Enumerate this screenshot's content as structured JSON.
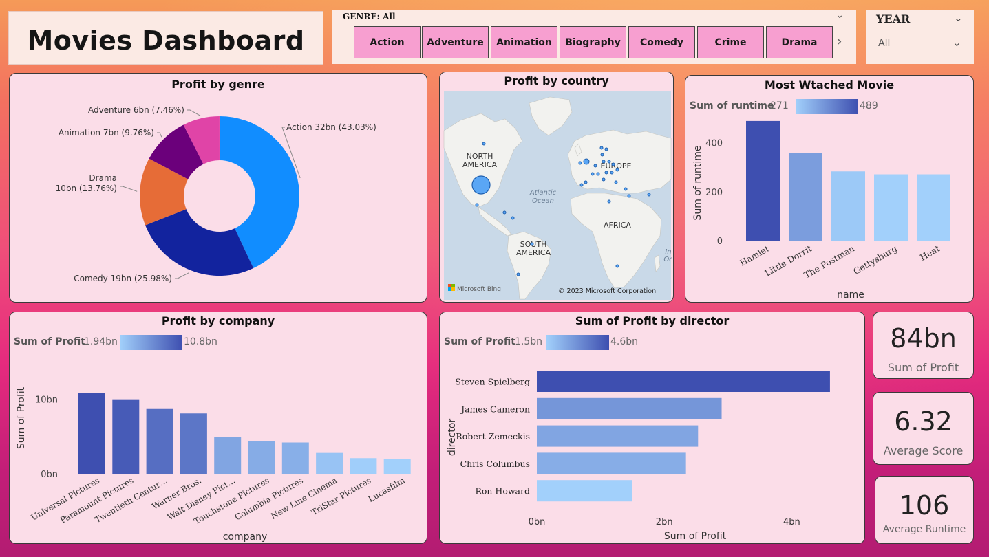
{
  "title": "Movies Dashboard",
  "genre_slicer": {
    "label": "GENRE: All",
    "buttons": [
      "Action",
      "Adventure",
      "Animation",
      "Biography",
      "Comedy",
      "Crime",
      "Drama"
    ]
  },
  "year_slicer": {
    "label": "YEAR",
    "value": "All"
  },
  "map": {
    "title": "Profit by country",
    "labels": [
      "NORTH\nAMERICA",
      "EUROPE",
      "AFRICA",
      "SOUTH\nAMERICA",
      "Atlantic\nOcean",
      "In\nOc"
    ],
    "attribution_bing": "Microsoft Bing",
    "copyright": "© 2023 Microsoft Corporation"
  },
  "kpis": [
    {
      "value": "84bn",
      "label": "Sum of Profit"
    },
    {
      "value": "6.32",
      "label": "Average Score"
    },
    {
      "value": "106",
      "label": "Average Runtime"
    }
  ],
  "chart_data": [
    {
      "type": "pie",
      "title": "Profit by genre",
      "donut": true,
      "slices": [
        {
          "label": "Action",
          "value": 32,
          "display": "Action 32bn (43.03%)",
          "color": "#118dff"
        },
        {
          "label": "Comedy",
          "value": 19,
          "display": "Comedy 19bn (25.98%)",
          "color": "#12239e"
        },
        {
          "label": "Drama",
          "value": 10,
          "display": "Drama\n10bn (13.76%)",
          "color": "#e66c37"
        },
        {
          "label": "Animation",
          "value": 7,
          "display": "Animation 7bn (9.76%)",
          "color": "#6b007b"
        },
        {
          "label": "Adventure",
          "value": 6,
          "display": "Adventure 6bn (7.46%)",
          "color": "#e044a7"
        }
      ],
      "percents": [
        43.03,
        25.98,
        13.76,
        9.76,
        7.46
      ]
    },
    {
      "type": "bar",
      "title": "Most Wtached Movie",
      "xlabel": "name",
      "ylabel": "Sum of runtime",
      "legend": {
        "label": "Sum of runtime",
        "min": "271",
        "max": "489"
      },
      "categories": [
        "Hamlet",
        "Little Dorrit",
        "The Postman",
        "Gettysburg",
        "Heat"
      ],
      "values": [
        489,
        357,
        283,
        271,
        271
      ],
      "ylim": [
        0,
        500
      ],
      "yticks": [
        "0",
        "200",
        "400"
      ],
      "ytick_values": [
        0,
        200,
        400
      ],
      "color_range": [
        "#a2d0fb",
        "#3e4fb0"
      ],
      "value_range": [
        271,
        489
      ]
    },
    {
      "type": "bar",
      "title": "Profit by company",
      "xlabel": "company",
      "ylabel": "Sum of Profit",
      "legend": {
        "label": "Sum of Profit",
        "min": "1.94bn",
        "max": "10.8bn"
      },
      "categories": [
        "Universal Pictures",
        "Paramount Pictures",
        "Twentieth Centur…",
        "Warner Bros.",
        "Walt Disney Pict…",
        "Touchstone Pictures",
        "Columbia Pictures",
        "New Line Cinema",
        "TriStar Pictures",
        "Lucasfilm"
      ],
      "values": [
        10.8,
        10.0,
        8.7,
        8.1,
        4.9,
        4.4,
        4.2,
        2.8,
        2.1,
        1.94
      ],
      "ylim": [
        0,
        12
      ],
      "yticks": [
        "0bn",
        "10bn"
      ],
      "ytick_values": [
        0,
        10
      ],
      "color_range": [
        "#a2d0fb",
        "#3e4fb0"
      ],
      "value_range": [
        1.94,
        10.8
      ]
    },
    {
      "type": "bar",
      "orientation": "horizontal",
      "title": "Sum of Profit by director",
      "xlabel": "Sum of Profit",
      "ylabel": "director",
      "legend": {
        "label": "Sum of Profit",
        "min": "1.5bn",
        "max": "4.6bn"
      },
      "categories": [
        "Steven Spielberg",
        "James Cameron",
        "Robert Zemeckis",
        "Chris Columbus",
        "Ron Howard"
      ],
      "values": [
        4.6,
        2.9,
        2.53,
        2.34,
        1.5
      ],
      "xlim": [
        0,
        5.4
      ],
      "xticks": [
        "0bn",
        "2bn",
        "4bn"
      ],
      "xtick_values": [
        0,
        2,
        4
      ],
      "color_range": [
        "#a2d0fb",
        "#3e4fb0"
      ],
      "value_range": [
        1.5,
        4.6
      ]
    }
  ]
}
